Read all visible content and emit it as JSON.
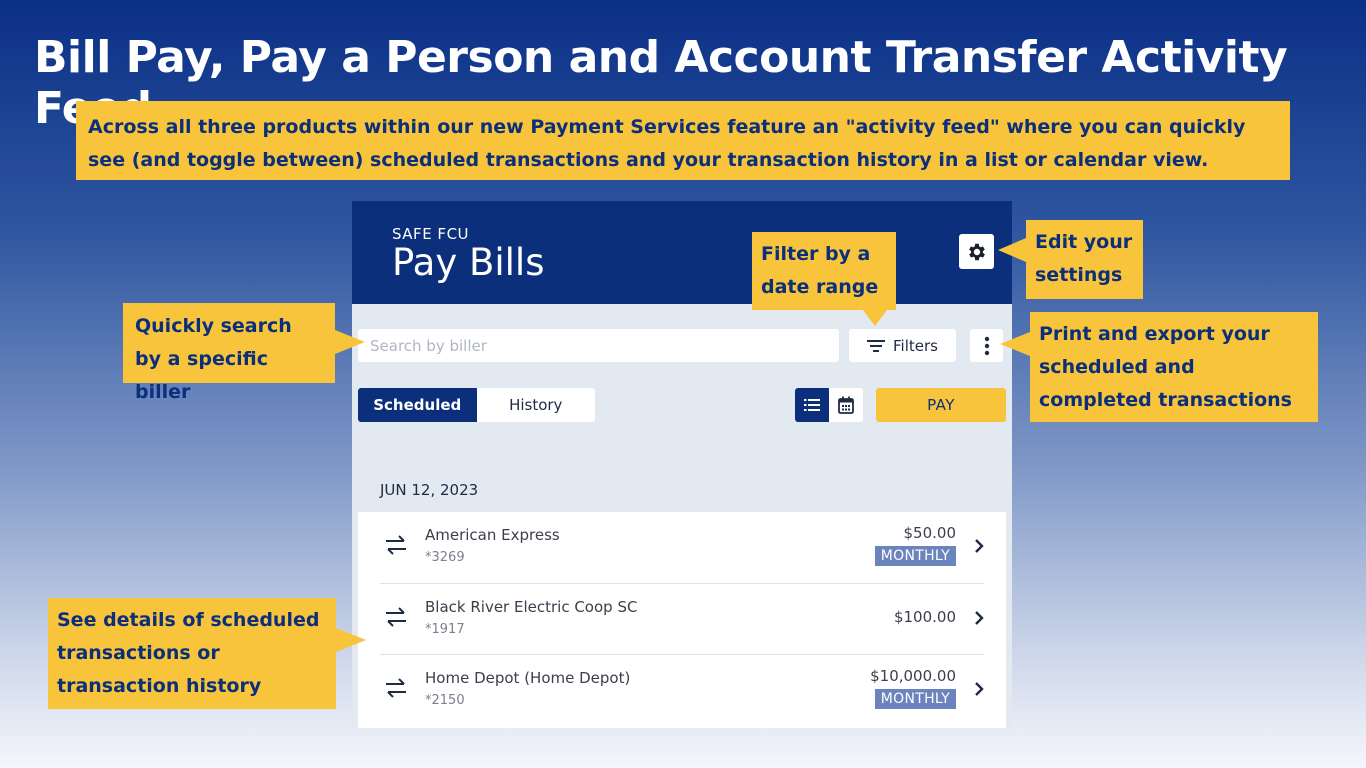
{
  "slide": {
    "title": "Bill Pay, Pay a Person and Account Transfer Activity Feed",
    "intro": "Across all three products within our new Payment Services feature an \"activity feed\" where you can quickly see (and toggle between) scheduled transactions and your transaction history in a list or calendar view."
  },
  "callouts": {
    "date_range": "Filter by a date range",
    "settings": "Edit your settings",
    "search": "Quickly search by a specific biller",
    "export": "Print and export your scheduled and completed transactions",
    "details": "See details of scheduled transactions or transaction history"
  },
  "app": {
    "brand": "SAFE FCU",
    "title": "Pay Bills",
    "search_placeholder": "Search by biller",
    "filters_label": "Filters",
    "tabs": [
      {
        "label": "Scheduled",
        "active": true
      },
      {
        "label": "History",
        "active": false
      }
    ],
    "pay_label": "PAY",
    "date_group": "JUN 12, 2023",
    "transactions": [
      {
        "biller": "American Express",
        "account": "*3269",
        "amount": "$50.00",
        "frequency": "MONTHLY"
      },
      {
        "biller": "Black River Electric Coop SC",
        "account": "*1917",
        "amount": "$100.00",
        "frequency": ""
      },
      {
        "biller": "Home Depot (Home Depot)",
        "account": "*2150",
        "amount": "$10,000.00",
        "frequency": "MONTHLY"
      }
    ]
  },
  "colors": {
    "navy": "#0b2f7a",
    "callout": "#f7c43c",
    "badge": "#6b84bd"
  },
  "icons": [
    "gear-icon",
    "filter-icon",
    "more-vertical-icon",
    "list-view-icon",
    "calendar-icon",
    "transfer-icon",
    "chevron-right-icon"
  ]
}
